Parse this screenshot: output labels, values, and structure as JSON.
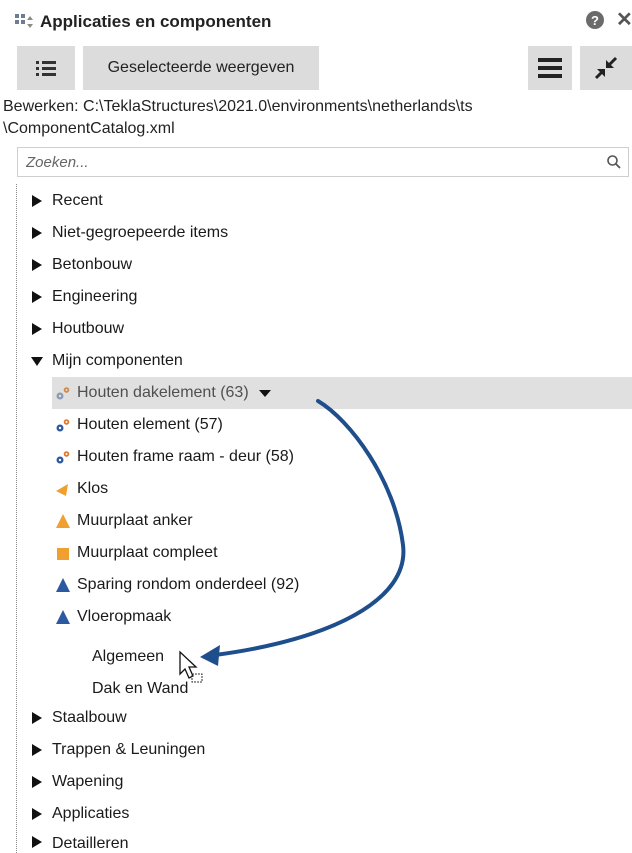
{
  "window": {
    "title": "Applicaties en componenten",
    "help_glyph": "?",
    "close_glyph": "✕"
  },
  "toolbar": {
    "show_selected_label": "Geselecteerde weergeven"
  },
  "path": {
    "line1": "Bewerken:  C:\\TeklaStructures\\2021.0\\environments\\netherlands\\ts",
    "line2": "\\ComponentCatalog.xml"
  },
  "search": {
    "placeholder": "Zoeken..."
  },
  "tree": {
    "top_items": [
      "Recent",
      "Niet-gegroepeerde items",
      "Betonbouw",
      "Engineering",
      "Houtbouw"
    ],
    "expanded_group": "Mijn componenten",
    "children": [
      {
        "label": "Houten dakelement (63)",
        "icon": "gears-icon"
      },
      {
        "label": "Houten element (57)",
        "icon": "gears-icon"
      },
      {
        "label": "Houten frame raam - deur (58)",
        "icon": "gears-icon"
      },
      {
        "label": "Klos",
        "icon": "orange-wedge-icon"
      },
      {
        "label": "Muurplaat anker",
        "icon": "orange-triangle-icon"
      },
      {
        "label": "Muurplaat compleet",
        "icon": "orange-square-icon"
      },
      {
        "label": "Sparing rondom onderdeel (92)",
        "icon": "blue-triangle-icon"
      },
      {
        "label": "Vloeropmaak",
        "icon": "blue-triangle-icon"
      }
    ],
    "leaves": [
      "Algemeen",
      "Dak en Wand"
    ],
    "bottom_items": [
      "Staalbouw",
      "Trappen & Leuningen",
      "Wapening",
      "Applicaties",
      "Detailleren"
    ]
  },
  "colors": {
    "accent_blue": "#1f4e8c",
    "gear_blue": "#2c5aa0",
    "orange": "#f0a030",
    "toolbar_gray": "#dcdcdc",
    "selection_gray": "#e0e0e0"
  }
}
